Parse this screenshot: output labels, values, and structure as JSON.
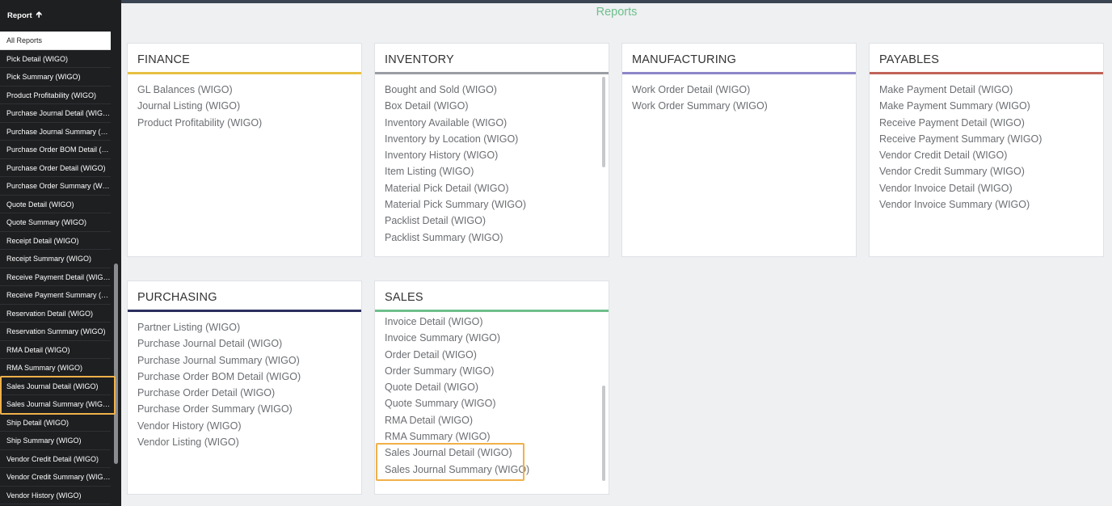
{
  "sidebar": {
    "header": "Report",
    "header_icon": "arrow-up-icon",
    "items": [
      {
        "label": "All Reports"
      },
      {
        "label": "Pick Detail (WIGO)"
      },
      {
        "label": "Pick Summary (WIGO)"
      },
      {
        "label": "Product Profitability (WIGO)"
      },
      {
        "label": "Purchase Journal Detail (WIGO)"
      },
      {
        "label": "Purchase Journal Summary (WI..."
      },
      {
        "label": "Purchase Order BOM Detail (WI..."
      },
      {
        "label": "Purchase Order Detail (WIGO)"
      },
      {
        "label": "Purchase Order Summary (WIG..."
      },
      {
        "label": "Quote Detail (WIGO)"
      },
      {
        "label": "Quote Summary (WIGO)"
      },
      {
        "label": "Receipt Detail (WIGO)"
      },
      {
        "label": "Receipt Summary (WIGO)"
      },
      {
        "label": "Receive Payment Detail (WIGO)"
      },
      {
        "label": "Receive Payment Summary (WI..."
      },
      {
        "label": "Reservation Detail (WIGO)"
      },
      {
        "label": "Reservation Summary (WIGO)"
      },
      {
        "label": "RMA Detail (WIGO)"
      },
      {
        "label": "RMA Summary (WIGO)"
      },
      {
        "label": "Sales Journal Detail (WIGO)"
      },
      {
        "label": "Sales Journal Summary (WIGO)"
      },
      {
        "label": "Ship Detail (WIGO)"
      },
      {
        "label": "Ship Summary (WIGO)"
      },
      {
        "label": "Vendor Credit Detail (WIGO)"
      },
      {
        "label": "Vendor Credit Summary (WIGO)"
      },
      {
        "label": "Vendor History (WIGO)"
      }
    ]
  },
  "page": {
    "title": "Reports"
  },
  "colors": {
    "finance": "#e8c043",
    "inventory": "#9a9ea4",
    "manufacturing": "#8d86c9",
    "payables": "#c0635a",
    "purchasing": "#2c2f5e",
    "sales": "#6fbf8c",
    "highlight": "#f0b14a"
  },
  "cards": {
    "finance": {
      "title": "FINANCE",
      "items": [
        "GL Balances (WIGO)",
        "Journal Listing (WIGO)",
        "Product Profitability (WIGO)"
      ]
    },
    "inventory": {
      "title": "INVENTORY",
      "items": [
        "Bought and Sold (WIGO)",
        "Box Detail (WIGO)",
        "Inventory Available (WIGO)",
        "Inventory by Location (WIGO)",
        "Inventory History (WIGO)",
        "Item Listing (WIGO)",
        "Material Pick Detail (WIGO)",
        "Material Pick Summary (WIGO)",
        "Packlist Detail (WIGO)",
        "Packlist Summary (WIGO)"
      ]
    },
    "manufacturing": {
      "title": "MANUFACTURING",
      "items": [
        "Work Order Detail (WIGO)",
        "Work Order Summary (WIGO)"
      ]
    },
    "payables": {
      "title": "PAYABLES",
      "items": [
        "Make Payment Detail (WIGO)",
        "Make Payment Summary (WIGO)",
        "Receive Payment Detail (WIGO)",
        "Receive Payment Summary (WIGO)",
        "Vendor Credit Detail (WIGO)",
        "Vendor Credit Summary (WIGO)",
        "Vendor Invoice Detail (WIGO)",
        "Vendor Invoice Summary (WIGO)"
      ]
    },
    "purchasing": {
      "title": "PURCHASING",
      "items": [
        "Partner Listing (WIGO)",
        "Purchase Journal Detail (WIGO)",
        "Purchase Journal Summary (WIGO)",
        "Purchase Order BOM Detail (WIGO)",
        "Purchase Order Detail (WIGO)",
        "Purchase Order Summary (WIGO)",
        "Vendor History (WIGO)",
        "Vendor Listing (WIGO)"
      ]
    },
    "sales": {
      "title": "SALES",
      "items": [
        "Invoice Detail (WIGO)",
        "Invoice Summary (WIGO)",
        "Order Detail (WIGO)",
        "Order Summary (WIGO)",
        "Quote Detail (WIGO)",
        "Quote Summary (WIGO)",
        "RMA Detail (WIGO)",
        "RMA Summary (WIGO)",
        "Sales Journal Detail (WIGO)",
        "Sales Journal Summary (WIGO)"
      ]
    }
  }
}
